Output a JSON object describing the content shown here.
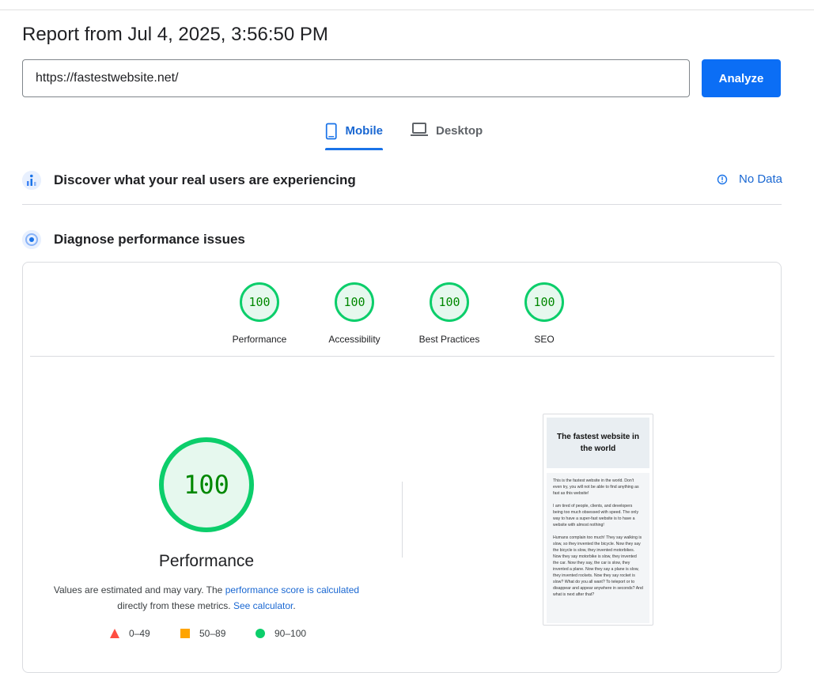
{
  "report": {
    "title": "Report from Jul 4, 2025, 3:56:50 PM",
    "url_value": "https://fastestwebsite.net/",
    "analyze_label": "Analyze"
  },
  "tabs": [
    {
      "label": "Mobile",
      "icon": "smartphone-icon",
      "active": true
    },
    {
      "label": "Desktop",
      "icon": "laptop-icon",
      "active": false
    }
  ],
  "field_data": {
    "title": "Discover what your real users are experiencing",
    "status": "No Data",
    "icon": "users-chart-icon",
    "status_icon": "info-icon"
  },
  "diagnose": {
    "title": "Diagnose performance issues",
    "icon": "lighthouse-icon"
  },
  "scores": [
    {
      "label": "Performance",
      "value": "100"
    },
    {
      "label": "Accessibility",
      "value": "100"
    },
    {
      "label": "Best Practices",
      "value": "100"
    },
    {
      "label": "SEO",
      "value": "100"
    }
  ],
  "performance": {
    "score": "100",
    "label": "Performance",
    "desc_text_1": "Values are estimated and may vary. The",
    "desc_link_1": "performance score is calculated",
    "desc_text_2": "directly from these metrics.",
    "desc_link_2": "See calculator",
    "desc_text_3": "."
  },
  "legend": [
    {
      "range": "0–49",
      "shape": "triangle",
      "color": "#ff4e42"
    },
    {
      "range": "50–89",
      "shape": "square",
      "color": "#ffa400"
    },
    {
      "range": "90–100",
      "shape": "circle",
      "color": "#0cce6b"
    }
  ],
  "preview": {
    "heading": "The fastest website in the world",
    "paragraphs": [
      "This is the fastest website in the world. Don't even try, you will not be able to find anything as fast as this website!",
      "I am tired of people, clients, and developers being too much obsessed with speed. The only way to have a super-fast website is to have a website with almost nothing!",
      "Humans complain too much! They say walking is slow, so they invented the bicycle. Now they say the bicycle is slow, they invented motorbikes. Now they say motorbike is slow, they invented the car. Now they say, the car is slow, they invented a plane. Now they say a plane is slow, they invented rockets. Now they say rocket is slow? What do you all want? To teleport or to disappear and appear anywhere in seconds? And what is next after that?"
    ]
  },
  "colors": {
    "accent": "#1a73e8",
    "pass": "#0cce6b",
    "pass_text": "#008800"
  }
}
